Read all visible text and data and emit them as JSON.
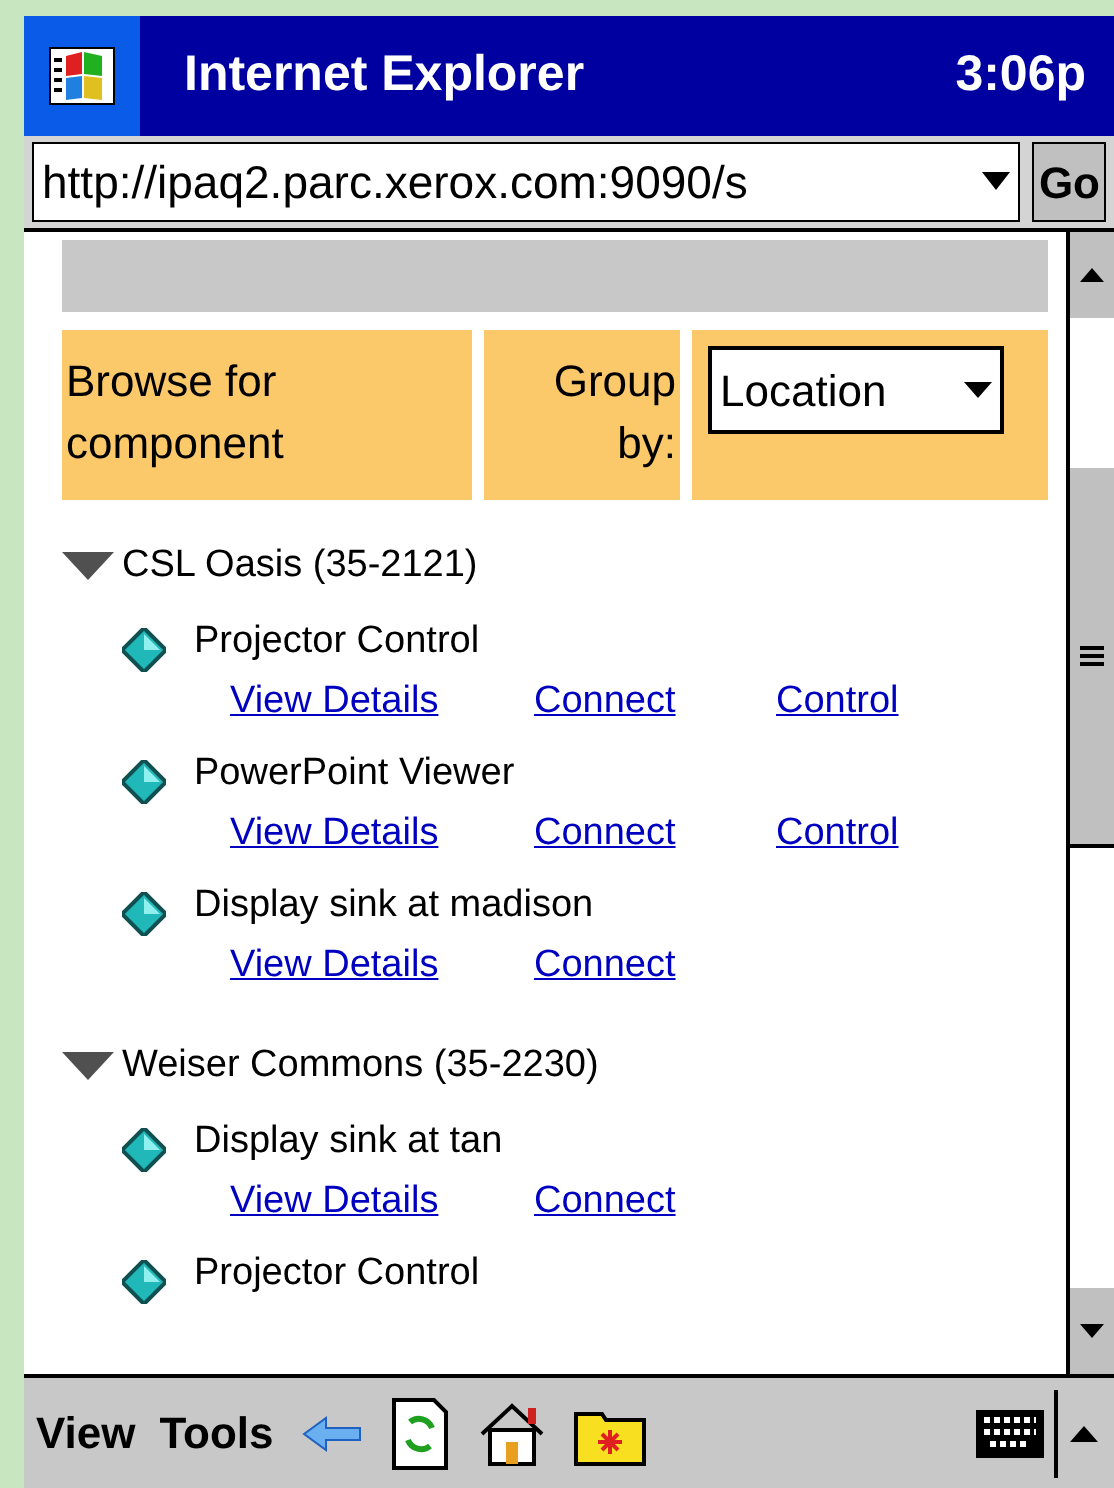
{
  "window": {
    "title": "Internet Explorer",
    "time": "3:06p"
  },
  "address_bar": {
    "url": "http://ipaq2.parc.xerox.com:9090/s",
    "go": "Go"
  },
  "header": {
    "browse_label": "Browse for component",
    "group_label": "Group by:",
    "group_select": "Location"
  },
  "groups": [
    {
      "name": "CSL Oasis (35-2121)",
      "expanded": true,
      "children": [
        {
          "name": "Projector Control",
          "links": [
            "View Details",
            "Connect",
            "Control"
          ]
        },
        {
          "name": "PowerPoint Viewer",
          "links": [
            "View Details",
            "Connect",
            "Control"
          ]
        },
        {
          "name": "Display sink at madison",
          "links": [
            "View Details",
            "Connect"
          ]
        }
      ]
    },
    {
      "name": "Weiser Commons (35-2230)",
      "expanded": true,
      "children": [
        {
          "name": "Display sink at tan",
          "links": [
            "View Details",
            "Connect"
          ]
        },
        {
          "name": "Projector Control"
        }
      ]
    }
  ],
  "menu_bar": {
    "items": [
      "View",
      "Tools"
    ]
  }
}
